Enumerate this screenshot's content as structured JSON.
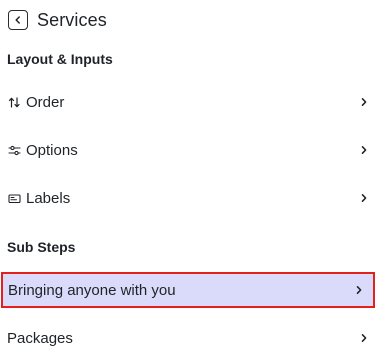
{
  "header": {
    "title": "Services",
    "back_icon": "chevron-left-icon"
  },
  "sections": {
    "layout_inputs": "Layout & Inputs",
    "sub_steps": "Sub Steps"
  },
  "items": {
    "order": {
      "label": "Order",
      "icon": "sort-arrows-icon"
    },
    "options": {
      "label": "Options",
      "icon": "sliders-icon"
    },
    "labels": {
      "label": "Labels",
      "icon": "label-tag-icon"
    },
    "bringing": {
      "label": "Bringing anyone with you"
    },
    "packages": {
      "label": "Packages"
    }
  },
  "colors": {
    "selected_bg": "#dadbfb",
    "selected_border": "#e2211c",
    "text": "#1f2328"
  }
}
